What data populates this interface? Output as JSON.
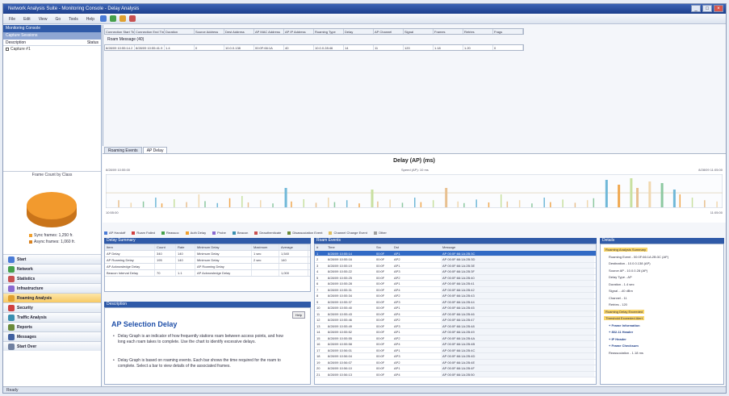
{
  "window": {
    "title": "Network Analysis Suite - Monitoring Console - Delay Analysis",
    "buttons": [
      "_",
      "□",
      "×"
    ]
  },
  "toolbar": {
    "items": [
      "File",
      "Edit",
      "View",
      "Go",
      "Tools",
      "Help"
    ]
  },
  "navigator": {
    "header": "Monitoring Console",
    "subheader": "Capture Sessions",
    "col_left": "Description",
    "col_right": "Status",
    "rows": [
      "Capture #1"
    ],
    "pie_title": "Frame Count by Class",
    "legend": [
      "Sync frames: 1,250 fr.",
      "Async frames: 1,060 fr."
    ]
  },
  "nav_buttons": [
    {
      "label": "Start",
      "color": "#4a7bd6"
    },
    {
      "label": "Network",
      "color": "#46a04b"
    },
    {
      "label": "Statistics",
      "color": "#c85050"
    },
    {
      "label": "Infrastructure",
      "color": "#8a6ad0"
    },
    {
      "label": "Roaming Analysis",
      "color": "#e0a030",
      "active": true
    },
    {
      "label": "Security",
      "color": "#d04040"
    },
    {
      "label": "Traffic Analysis",
      "color": "#3a8fb0"
    },
    {
      "label": "Reports",
      "color": "#6a8a3a"
    },
    {
      "label": "Messages",
      "color": "#4060a0"
    },
    {
      "label": "Start Over",
      "color": "#7080a0"
    }
  ],
  "grid": {
    "headers": [
      "Connection Start Time",
      "Connection End Time",
      "Duration",
      "Source Address",
      "Dest Address",
      "AP MAC Address",
      "AP IP Address",
      "Roaming Type",
      "Delay",
      "AP Channel",
      "Signal",
      "Frames",
      "Retries",
      "Frags"
    ],
    "group_label": "Roam Message (40)",
    "row": [
      "8/28/09 10:55:14.2",
      "8/28/09 10:55:41.9",
      "1.4",
      "0",
      "10.0.0.138",
      "00:0F:66:1A",
      "40",
      "10.0.0.28:46",
      "14",
      "11",
      "120",
      "1.18",
      "1.20",
      "0"
    ]
  },
  "tabs": [
    "Roaming Events",
    "AP Delay"
  ],
  "chart_data": {
    "type": "bar",
    "title": "Delay (AP) (ms)",
    "left_meta": "8/28/09 10:55:00",
    "center_meta": "Speed (AP): 10 ms",
    "right_meta": "8/28/09 11:05:00",
    "bottom_left": "10:55:00",
    "bottom_right": "11:05:00",
    "x": [
      2,
      4,
      6,
      8,
      9,
      11,
      13,
      15,
      16,
      18,
      20,
      22,
      23,
      25,
      27,
      29,
      30,
      32,
      34,
      36,
      37,
      39,
      41,
      43,
      44,
      46,
      48,
      50,
      51,
      53,
      55,
      57,
      58,
      60,
      62,
      64,
      65,
      67,
      69,
      71,
      72,
      74,
      76,
      78,
      79,
      81,
      83,
      85,
      86,
      88,
      90,
      92,
      93,
      95,
      97,
      99
    ],
    "values": [
      22,
      14,
      18,
      30,
      12,
      25,
      16,
      40,
      19,
      13,
      28,
      35,
      15,
      22,
      12,
      60,
      18,
      25,
      14,
      30,
      16,
      22,
      12,
      55,
      18,
      24,
      14,
      30,
      16,
      22,
      60,
      18,
      13,
      24,
      15,
      40,
      18,
      22,
      12,
      30,
      16,
      24,
      14,
      22,
      28,
      85,
      70,
      90,
      60,
      80,
      75,
      55,
      40,
      30,
      22,
      18
    ],
    "series_colors": [
      "#e8c090",
      "#f0d8b0",
      "#8cc8a0",
      "#70b8d8",
      "#f0a850",
      "#c8e0a0"
    ]
  },
  "legend_bar": [
    {
      "label": "AP Handoff",
      "color": "#4a7bd6"
    },
    {
      "label": "Roam Failed",
      "color": "#d04040"
    },
    {
      "label": "Reassoc",
      "color": "#46a04b"
    },
    {
      "label": "Auth Delay",
      "color": "#f0a030"
    },
    {
      "label": "Probe",
      "color": "#8a6ad0"
    },
    {
      "label": "Beacon",
      "color": "#3a8fb0"
    },
    {
      "label": "Deauthenticate",
      "color": "#c85050"
    },
    {
      "label": "Disassociation Event",
      "color": "#6a8a3a"
    },
    {
      "label": "Channel Change Event",
      "color": "#e0c060"
    },
    {
      "label": "Other",
      "color": "#a0a0a0"
    }
  ],
  "stats_panel": {
    "header": "Delay Summary",
    "columns": [
      "Item",
      "Count",
      "Rate",
      "Minimum Delay",
      "Maximum",
      "Average"
    ],
    "rows": [
      [
        "AP Delay",
        "340",
        "140",
        "Minimum Delay",
        "1 sec",
        "1,540"
      ],
      [
        "AP Roaming Delay",
        "195",
        "140",
        "Minimum Delay",
        "2 sec",
        "140"
      ],
      [
        "AP Acknowledge Delay",
        "",
        "",
        "AP Roaming Delay",
        "",
        ""
      ],
      [
        "Beacon Interval Delay",
        "70",
        "1.1",
        "AP Acknowledge Delay",
        "",
        "1,000"
      ]
    ]
  },
  "description_panel": {
    "header": "Description",
    "button": "Help",
    "title": "AP Selection Delay",
    "paragraphs": [
      "Delay Graph is an indicator of how frequently stations roam between access points, and how long each roam takes to complete. Use the chart to identify excessive delays.",
      "Delay Graph is based on roaming events. Each bar shows the time required for the roam to complete. Select a bar to view details of the associated frames."
    ]
  },
  "list_panel": {
    "header": "Roam Events",
    "columns": [
      "#",
      "Time",
      "Src",
      "Dst",
      "Message"
    ],
    "rows": [
      [
        "1",
        "8/28/09 10:55:14",
        "00:0F",
        "AP1",
        "AP 00:0F:66:1A:2B:3C"
      ],
      [
        "2",
        "8/28/09 10:55:16",
        "00:0F",
        "AP2",
        "AP 00:0F:66:1A:2B:3D"
      ],
      [
        "3",
        "8/28/09 10:55:19",
        "00:0F",
        "AP1",
        "AP 00:0F:66:1A:2B:3E"
      ],
      [
        "4",
        "8/28/09 10:55:22",
        "00:0F",
        "AP3",
        "AP 00:0F:66:1A:2B:3F"
      ],
      [
        "5",
        "8/28/09 10:55:25",
        "00:0F",
        "AP2",
        "AP 00:0F:66:1A:2B:40"
      ],
      [
        "6",
        "8/28/09 10:55:28",
        "00:0F",
        "AP1",
        "AP 00:0F:66:1A:2B:41"
      ],
      [
        "7",
        "8/28/09 10:55:31",
        "00:0F",
        "AP4",
        "AP 00:0F:66:1A:2B:42"
      ],
      [
        "8",
        "8/28/09 10:55:34",
        "00:0F",
        "AP2",
        "AP 00:0F:66:1A:2B:43"
      ],
      [
        "9",
        "8/28/09 10:55:37",
        "00:0F",
        "AP3",
        "AP 00:0F:66:1A:2B:44"
      ],
      [
        "10",
        "8/28/09 10:55:40",
        "00:0F",
        "AP1",
        "AP 00:0F:66:1A:2B:45"
      ],
      [
        "11",
        "8/28/09 10:55:43",
        "00:0F",
        "AP4",
        "AP 00:0F:66:1A:2B:46"
      ],
      [
        "12",
        "8/28/09 10:55:46",
        "00:0F",
        "AP2",
        "AP 00:0F:66:1A:2B:47"
      ],
      [
        "13",
        "8/28/09 10:55:49",
        "00:0F",
        "AP3",
        "AP 00:0F:66:1A:2B:48"
      ],
      [
        "14",
        "8/28/09 10:55:52",
        "00:0F",
        "AP1",
        "AP 00:0F:66:1A:2B:49"
      ],
      [
        "15",
        "8/28/09 10:55:55",
        "00:0F",
        "AP2",
        "AP 00:0F:66:1A:2B:4A"
      ],
      [
        "16",
        "8/28/09 10:55:58",
        "00:0F",
        "AP4",
        "AP 00:0F:66:1A:2B:4B"
      ],
      [
        "17",
        "8/28/09 10:56:01",
        "00:0F",
        "AP1",
        "AP 00:0F:66:1A:2B:4C"
      ],
      [
        "18",
        "8/28/09 10:56:04",
        "00:0F",
        "AP3",
        "AP 00:0F:66:1A:2B:4D"
      ],
      [
        "19",
        "8/28/09 10:56:07",
        "00:0F",
        "AP2",
        "AP 00:0F:66:1A:2B:4E"
      ],
      [
        "20",
        "8/28/09 10:56:10",
        "00:0F",
        "AP1",
        "AP 00:0F:66:1A:2B:4F"
      ],
      [
        "21",
        "8/28/09 10:56:13",
        "00:0F",
        "AP4",
        "AP 00:0F:66:1A:2B:50"
      ]
    ]
  },
  "tree_panel": {
    "header": "Details",
    "items": [
      {
        "text": "Roaming Analysis Summary",
        "hl": true
      },
      {
        "text": "Roaming Event - 00:0F:66:1A:2B:3C (AP)",
        "hl": false
      },
      {
        "text": "Destination - 10.0.0.138 (AP)",
        "hl": false
      },
      {
        "text": "Source AP - 10.0.0.28 (AP)",
        "hl": false
      },
      {
        "text": "Delay Type - AP",
        "hl": false
      },
      {
        "text": "Duration - 1.4 sec",
        "hl": false
      },
      {
        "text": "Signal - -40 dBm",
        "hl": false
      },
      {
        "text": "Channel - 11",
        "hl": false
      },
      {
        "text": "Retries - 120",
        "hl": false
      },
      {
        "text": "Roaming Delay Exceeded",
        "hl": true
      },
      {
        "text": "Threshold Exceeded Alert",
        "hl": true
      },
      {
        "text": "+ Frame Information",
        "hl": false,
        "bold": true
      },
      {
        "text": "+ 802.11 Header",
        "hl": false,
        "bold": true
      },
      {
        "text": "+ IP Header",
        "hl": false,
        "bold": true
      },
      {
        "text": "+ Frame Checksum",
        "hl": false,
        "bold": true
      },
      {
        "text": "Reassociation - 1.18 ms",
        "hl": false
      }
    ]
  },
  "statusbar": "Ready"
}
